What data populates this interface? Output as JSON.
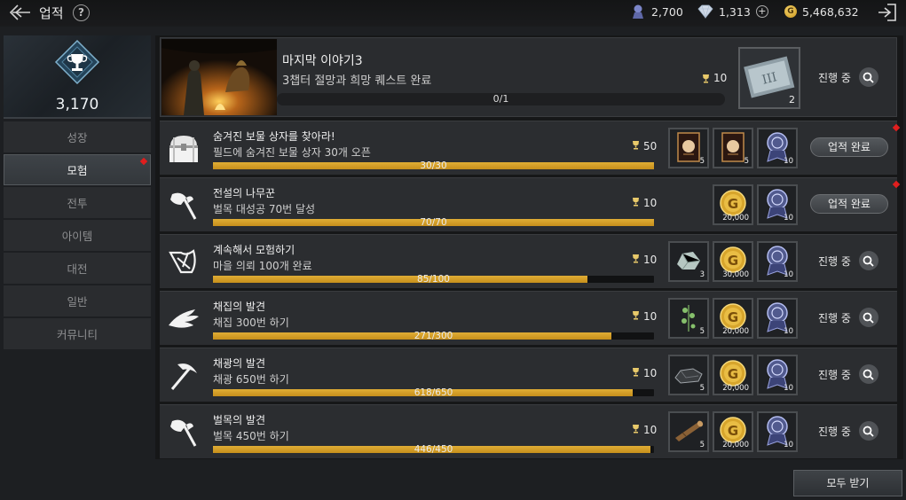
{
  "header": {
    "title": "업적",
    "help_icon": "?",
    "currencies": [
      {
        "icon": "medal-icon",
        "value": "2,700"
      },
      {
        "icon": "diamond-icon",
        "value": "1,313",
        "plus": "+"
      },
      {
        "icon": "gold-coin-icon",
        "symbol": "G",
        "value": "5,468,632"
      }
    ]
  },
  "sidebar": {
    "score": "3,170",
    "items": [
      {
        "label": "성장"
      },
      {
        "label": "모험"
      },
      {
        "label": "전투"
      },
      {
        "label": "아이템"
      },
      {
        "label": "대전"
      },
      {
        "label": "일반"
      },
      {
        "label": "커뮤니티"
      }
    ]
  },
  "featured": {
    "title": "마지막 이야기3",
    "desc": "3챕터 절망과 희망 퀘스트 완료",
    "progress": "0/1",
    "progress_fraction": 0,
    "trophy": "10",
    "reward_qty": "2",
    "status": "진행 중"
  },
  "achievements": [
    {
      "icon": "treasure-chest-icon",
      "title": "숨겨진 보물 상자를 찾아라!",
      "desc": "필드에 숨겨진 보물 상자 30개 오픈",
      "progress": "30/30",
      "fraction": 1.0,
      "trophy": "50",
      "rewards": [
        {
          "icon": "card-icon",
          "qty": "5"
        },
        {
          "icon": "card-icon",
          "qty": "5"
        },
        {
          "icon": "medal-token-icon",
          "qty": "10"
        }
      ],
      "status": "업적 완료",
      "complete": true
    },
    {
      "icon": "axe-icon",
      "title": "전설의 나무꾼",
      "desc": "벌목 대성공 70번 달성",
      "progress": "70/70",
      "fraction": 1.0,
      "trophy": "10",
      "rewards": [
        {
          "icon": "gold-coin-icon",
          "qty": "20,000"
        },
        {
          "icon": "medal-token-icon",
          "qty": "10"
        }
      ],
      "status": "업적 완료",
      "complete": true
    },
    {
      "icon": "map-icon",
      "title": "계속해서 모험하기",
      "desc": "마을 의뢰 100개 완료",
      "progress": "85/100",
      "fraction": 0.85,
      "trophy": "10",
      "rewards": [
        {
          "icon": "ore-icon",
          "qty": "3"
        },
        {
          "icon": "gold-coin-icon",
          "qty": "30,000"
        },
        {
          "icon": "medal-token-icon",
          "qty": "10"
        }
      ],
      "status": "진행 중",
      "complete": false
    },
    {
      "icon": "gather-hand-icon",
      "title": "채집의 발견",
      "desc": "채집 300번 하기",
      "progress": "271/300",
      "fraction": 0.903,
      "trophy": "10",
      "rewards": [
        {
          "icon": "herb-icon",
          "qty": "5"
        },
        {
          "icon": "gold-coin-icon",
          "qty": "20,000"
        },
        {
          "icon": "medal-token-icon",
          "qty": "10"
        }
      ],
      "status": "진행 중",
      "complete": false
    },
    {
      "icon": "pickaxe-icon",
      "title": "채광의 발견",
      "desc": "채광 650번 하기",
      "progress": "618/650",
      "fraction": 0.951,
      "trophy": "10",
      "rewards": [
        {
          "icon": "rock-icon",
          "qty": "5"
        },
        {
          "icon": "gold-coin-icon",
          "qty": "20,000"
        },
        {
          "icon": "medal-token-icon",
          "qty": "10"
        }
      ],
      "status": "진행 중",
      "complete": false
    },
    {
      "icon": "axe-icon",
      "title": "벌목의 발견",
      "desc": "벌목 450번 하기",
      "progress": "446/450",
      "fraction": 0.991,
      "trophy": "10",
      "rewards": [
        {
          "icon": "log-icon",
          "qty": "5"
        },
        {
          "icon": "gold-coin-icon",
          "qty": "20,000"
        },
        {
          "icon": "medal-token-icon",
          "qty": "10"
        }
      ],
      "status": "진행 중",
      "complete": false
    }
  ],
  "footer": {
    "claim_all": "모두 받기"
  },
  "colors": {
    "accent_gold": "#d9a12b",
    "alert_red": "#e01e1e",
    "panel": "#2b2d30"
  }
}
